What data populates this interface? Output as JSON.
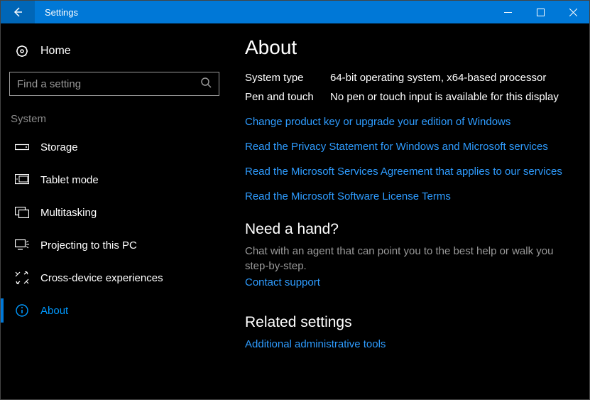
{
  "window": {
    "title": "Settings"
  },
  "sidebar": {
    "home": "Home",
    "search_placeholder": "Find a setting",
    "category": "System",
    "items": [
      {
        "label": "Storage"
      },
      {
        "label": "Tablet mode"
      },
      {
        "label": "Multitasking"
      },
      {
        "label": "Projecting to this PC"
      },
      {
        "label": "Cross-device experiences"
      },
      {
        "label": "About"
      }
    ]
  },
  "main": {
    "title": "About",
    "system_type_label": "System type",
    "system_type_value": "64-bit operating system, x64-based processor",
    "pen_label": "Pen and touch",
    "pen_value": "No pen or touch input is available for this display",
    "links": {
      "product_key": "Change product key or upgrade your edition of Windows",
      "privacy": "Read the Privacy Statement for Windows and Microsoft services",
      "services_agreement": "Read the Microsoft Services Agreement that applies to our services",
      "license_terms": "Read the Microsoft Software License Terms"
    },
    "need_hand_title": "Need a hand?",
    "need_hand_text": "Chat with an agent that can point you to the best help or walk you step-by-step.",
    "contact_support": "Contact support",
    "related_title": "Related settings",
    "admin_tools": "Additional administrative tools"
  }
}
